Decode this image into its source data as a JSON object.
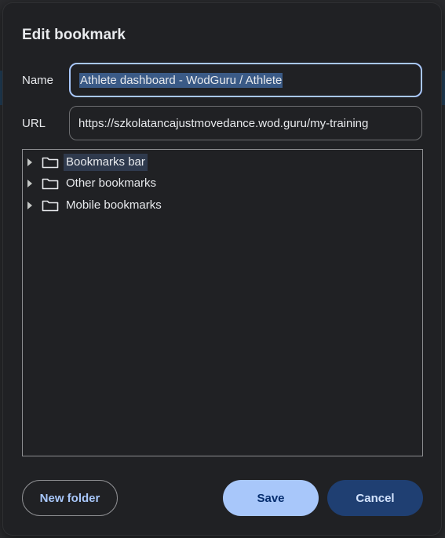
{
  "dialog": {
    "title": "Edit bookmark",
    "name_label": "Name",
    "name_value": "Athlete dashboard - WodGuru / Athlete",
    "url_label": "URL",
    "url_value": "https://szkolatancajustmovedance.wod.guru/my-training"
  },
  "tree": {
    "items": [
      {
        "label": "Bookmarks bar",
        "selected": true
      },
      {
        "label": "Other bookmarks",
        "selected": false
      },
      {
        "label": "Mobile bookmarks",
        "selected": false
      }
    ]
  },
  "buttons": {
    "new_folder": "New folder",
    "save": "Save",
    "cancel": "Cancel"
  },
  "colors": {
    "accent": "#a8c7fa",
    "dialog_bg": "#202124",
    "cancel_bg": "#1f3f72"
  }
}
